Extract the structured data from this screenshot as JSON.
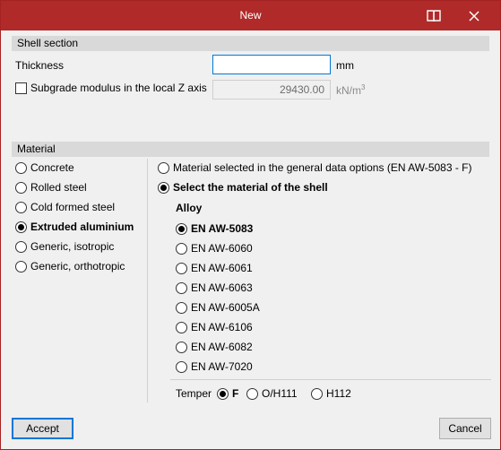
{
  "window": {
    "title": "New",
    "colors": {
      "titlebar": "#b02a2a",
      "accent": "#0078d7"
    }
  },
  "shell_section": {
    "header": "Shell section",
    "thickness_label": "Thickness",
    "thickness_value": "",
    "thickness_unit": "mm",
    "subgrade_label": "Subgrade modulus in the local Z axis",
    "subgrade_checked": false,
    "subgrade_value": "29430.00",
    "subgrade_unit": "kN/m",
    "subgrade_unit_exp": "3"
  },
  "material": {
    "header": "Material",
    "types": [
      {
        "label": "Concrete",
        "checked": false
      },
      {
        "label": "Rolled steel",
        "checked": false
      },
      {
        "label": "Cold formed steel",
        "checked": false
      },
      {
        "label": "Extruded aluminium",
        "checked": true
      },
      {
        "label": "Generic, isotropic",
        "checked": false
      },
      {
        "label": "Generic, orthotropic",
        "checked": false
      }
    ],
    "source_general": "Material selected in the general data options (EN AW-5083 - F)",
    "source_shell": "Select the material of the shell",
    "alloy_label": "Alloy",
    "alloys": [
      {
        "label": "EN AW-5083",
        "checked": true
      },
      {
        "label": "EN AW-6060",
        "checked": false
      },
      {
        "label": "EN AW-6061",
        "checked": false
      },
      {
        "label": "EN AW-6063",
        "checked": false
      },
      {
        "label": "EN AW-6005A",
        "checked": false
      },
      {
        "label": "EN AW-6106",
        "checked": false
      },
      {
        "label": "EN AW-6082",
        "checked": false
      },
      {
        "label": "EN AW-7020",
        "checked": false
      }
    ],
    "temper_label": "Temper",
    "tempers": [
      {
        "label": "F",
        "checked": true
      },
      {
        "label": "O/H111",
        "checked": false
      },
      {
        "label": "H112",
        "checked": false
      }
    ]
  },
  "footer": {
    "accept_label": "Accept",
    "cancel_label": "Cancel"
  },
  "icons": {
    "help": "book-icon",
    "close": "close-icon"
  }
}
